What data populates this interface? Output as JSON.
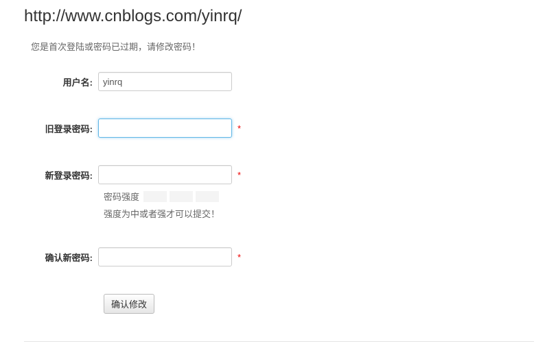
{
  "header": {
    "url": "http://www.cnblogs.com/yinrq/"
  },
  "notice": "您是首次登陆或密码已过期，请修改密码！",
  "form": {
    "username": {
      "label": "用户名:",
      "value": "yinrq"
    },
    "old_password": {
      "label": "旧登录密码:",
      "value": "",
      "required": "*"
    },
    "new_password": {
      "label": "新登录密码:",
      "value": "",
      "required": "*"
    },
    "strength": {
      "label": "密码强度",
      "hint": "强度为中或者强才可以提交！"
    },
    "confirm_password": {
      "label": "确认新密码:",
      "value": "",
      "required": "*"
    },
    "submit": {
      "label": "确认修改"
    }
  }
}
